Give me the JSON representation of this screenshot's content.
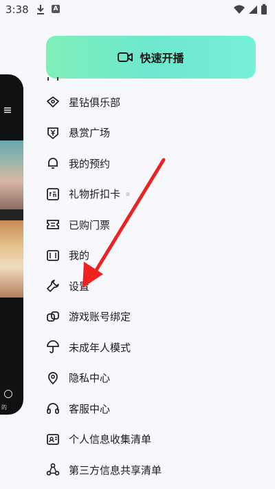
{
  "status_bar": {
    "time": "3:38",
    "download_icon": "download-icon",
    "app_badge": "A",
    "wifi_icon": "wifi-icon",
    "battery_icon": "battery-icon"
  },
  "start_button": {
    "label": "快速开播",
    "icon": "video-camera-icon"
  },
  "menu": {
    "items": [
      {
        "label": "",
        "icon": "partial-icon"
      },
      {
        "label": "星钻俱乐部",
        "icon": "diamond-icon"
      },
      {
        "label": "悬赏广场",
        "icon": "bounty-shield-icon"
      },
      {
        "label": "我的预约",
        "icon": "bell-icon"
      },
      {
        "label": "礼物折扣卡",
        "icon": "discount-card-icon"
      },
      {
        "label": "已购门票",
        "icon": "ticket-icon"
      },
      {
        "label": "我的",
        "icon": "wallet-icon"
      },
      {
        "label": "设置",
        "icon": "wrench-icon"
      },
      {
        "label": "游戏账号绑定",
        "icon": "link-icon"
      },
      {
        "label": "未成年人模式",
        "icon": "umbrella-icon"
      },
      {
        "label": "隐私中心",
        "icon": "location-shield-icon"
      },
      {
        "label": "客服中心",
        "icon": "headset-icon"
      },
      {
        "label": "个人信息收集清单",
        "icon": "id-card-icon"
      },
      {
        "label": "第三方信息共享清单",
        "icon": "share-nodes-icon"
      }
    ]
  },
  "annotation": {
    "color": "#ee2222"
  },
  "side_panel": {
    "caption": "的"
  }
}
